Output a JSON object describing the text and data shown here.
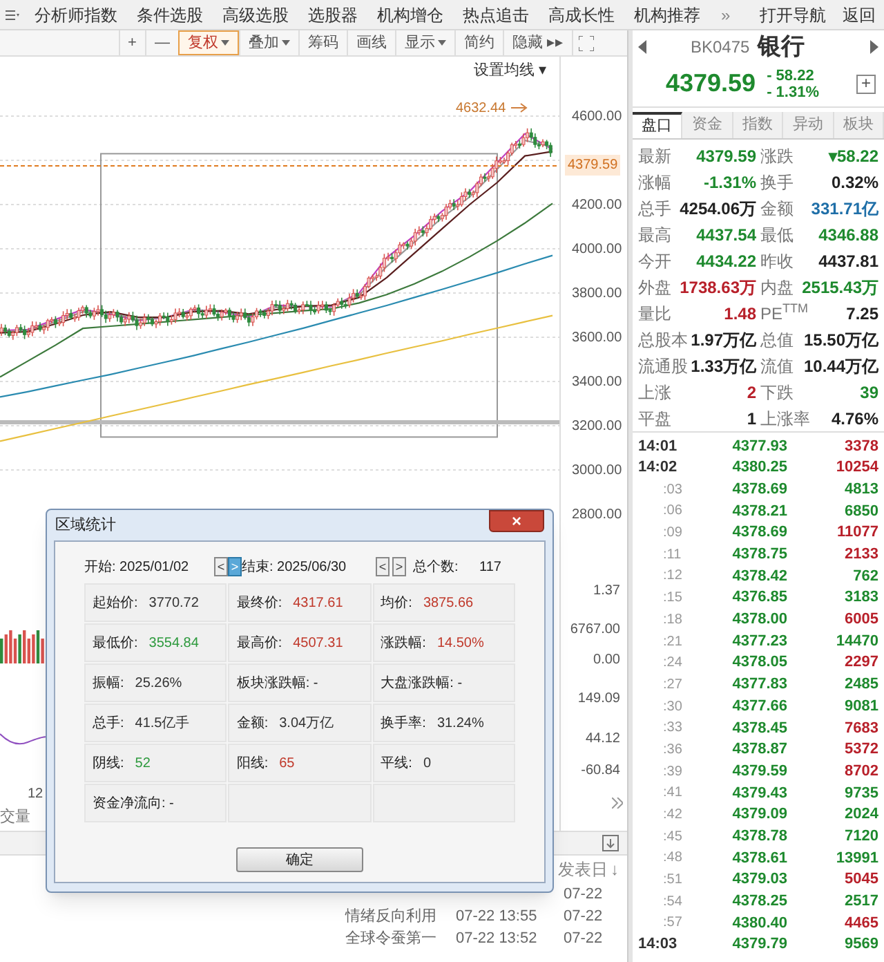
{
  "nav": {
    "items": [
      "分析师指数",
      "条件选股",
      "高级选股",
      "选股器",
      "机构增仓",
      "热点追击",
      "高成长性",
      "机构推荐"
    ],
    "more": "»",
    "right": [
      "打开导航",
      "返回"
    ]
  },
  "toolbar": {
    "buttons": [
      {
        "label": "+",
        "dropdown": false,
        "selected": false
      },
      {
        "label": "—",
        "dropdown": false,
        "selected": false
      },
      {
        "label": "复权",
        "dropdown": true,
        "selected": true
      },
      {
        "label": "叠加",
        "dropdown": true,
        "selected": false
      },
      {
        "label": "筹码",
        "dropdown": false,
        "selected": false
      },
      {
        "label": "画线",
        "dropdown": false,
        "selected": false
      },
      {
        "label": "显示",
        "dropdown": true,
        "selected": false
      },
      {
        "label": "简约",
        "dropdown": false,
        "selected": false
      },
      {
        "label": "隐藏 ▸▸",
        "dropdown": false,
        "selected": false
      }
    ],
    "ma_setting": "设置均线 ▾"
  },
  "chart": {
    "chart_data": {
      "type": "line",
      "yticks": [
        {
          "value": 4600,
          "label": "4600.00"
        },
        {
          "value": 4200,
          "label": "4200.00"
        },
        {
          "value": 4000,
          "label": "4000.00"
        },
        {
          "value": 3800,
          "label": "3800.00"
        },
        {
          "value": 3600,
          "label": "3600.00"
        },
        {
          "value": 3400,
          "label": "3400.00"
        },
        {
          "value": 3200,
          "label": "3200.00"
        },
        {
          "value": 3000,
          "label": "3000.00"
        },
        {
          "value": 2800,
          "label": "2800.00"
        }
      ],
      "ylim": [
        1368.75,
        4868.75
      ],
      "grid": true,
      "series": [
        {
          "color": "#c040c0",
          "values": [
            3630,
            3635,
            3680,
            3725,
            3705,
            3675,
            3690,
            3725,
            3715,
            3692,
            3745,
            3740,
            3738,
            3800,
            3960,
            4060,
            4170,
            4260,
            4390,
            4520,
            4450
          ]
        },
        {
          "color": "#999999",
          "values": [
            3625,
            3630,
            3670,
            3715,
            3710,
            3680,
            3690,
            3720,
            3718,
            3698,
            3735,
            3742,
            3742,
            3790,
            3920,
            4030,
            4140,
            4235,
            4360,
            4490,
            4460
          ]
        },
        {
          "color": "#5a1f1f",
          "values": [
            3620,
            3625,
            3660,
            3700,
            3715,
            3690,
            3690,
            3715,
            3720,
            3705,
            3725,
            3740,
            3745,
            3780,
            3870,
            3980,
            4090,
            4200,
            4300,
            4420,
            4440
          ]
        },
        {
          "color": "#3d7a3d",
          "values": [
            3420,
            3492,
            3564,
            3640,
            3650,
            3660,
            3670,
            3680,
            3690,
            3700,
            3710,
            3720,
            3729,
            3755,
            3793,
            3841,
            3898,
            3964,
            4036,
            4116,
            4205
          ]
        },
        {
          "color": "#2a8bb0",
          "values": [
            3330,
            3354,
            3380,
            3406,
            3432,
            3460,
            3488,
            3517,
            3548,
            3578,
            3610,
            3642,
            3676,
            3710,
            3744,
            3780,
            3816,
            3854,
            3892,
            3932,
            3970
          ]
        },
        {
          "color": "#e8c040",
          "values": [
            3130,
            3158,
            3187,
            3215,
            3244,
            3272,
            3300,
            3329,
            3357,
            3386,
            3414,
            3442,
            3471,
            3499,
            3528,
            3556,
            3584,
            3613,
            3641,
            3670,
            3698
          ]
        }
      ]
    },
    "high_label": "4632.44",
    "current_price": "4379.59",
    "lower_axis": [
      "1.37",
      "6767.00",
      "0.00",
      "149.09",
      "44.12",
      "-60.84"
    ],
    "x_label": "12",
    "panel_label": "交量"
  },
  "news": {
    "column": "发表日",
    "sort_arrow": "↓",
    "rows": [
      {
        "date": "07-22"
      },
      {
        "title": "情绪反向利用",
        "time": "07-22 13:55",
        "date": "07-22"
      },
      {
        "title": "全球令蚕第一",
        "time": "07-22 13:52",
        "date": "07-22"
      }
    ]
  },
  "dialog": {
    "title": "区域统计",
    "close": "×",
    "start": "开始: 2025/01/02",
    "end": "结束: 2025/06/30",
    "count_label": "总个数:",
    "count": "117",
    "arrows": [
      {
        "label": "<",
        "selected": false
      },
      {
        "label": ">",
        "selected": true
      },
      {
        "label": "<",
        "selected": false
      },
      {
        "label": ">",
        "selected": false
      }
    ],
    "cells": [
      {
        "kind": "stat",
        "label": "起始价:",
        "value": "3770.72"
      },
      {
        "kind": "stat",
        "label": "最终价:",
        "value": "4317.61",
        "color": "#c0392b"
      },
      {
        "kind": "stat",
        "label": "均价:",
        "value": "3875.66",
        "color": "#c0392b"
      },
      {
        "kind": "stat",
        "label": "最低价:",
        "value": "3554.84",
        "color": "#2e9a3e"
      },
      {
        "kind": "stat",
        "label": "最高价:",
        "value": "4507.31",
        "color": "#c0392b"
      },
      {
        "kind": "stat",
        "label": "涨跌幅:",
        "value": "14.50%",
        "color": "#c0392b"
      },
      {
        "kind": "stat",
        "label": "振幅:",
        "value": "25.26%"
      },
      {
        "kind": "stat",
        "label": "板块涨跌幅: -"
      },
      {
        "kind": "stat",
        "label": "大盘涨跌幅: -"
      },
      {
        "kind": "stat",
        "label": "总手:",
        "value": "41.5亿手"
      },
      {
        "kind": "stat",
        "label": "金额:",
        "value": "3.04万亿"
      },
      {
        "kind": "stat",
        "label": "换手率:",
        "value": "31.24%"
      },
      {
        "kind": "stat",
        "label": "阴线:",
        "value": "52",
        "color": "#2e9a3e"
      },
      {
        "kind": "stat",
        "label": "阳线:",
        "value": "65",
        "color": "#c0392b"
      },
      {
        "kind": "stat",
        "label": "平线:",
        "value": "0"
      },
      {
        "kind": "stat",
        "label": "资金净流向: -"
      },
      {
        "kind": "empty"
      },
      {
        "kind": "empty"
      }
    ],
    "ok": "确定"
  },
  "quote": {
    "code": "BK0475",
    "name": "银行",
    "price": "4379.59",
    "change": "- 58.22",
    "pct": "- 1.31%",
    "plus": "+",
    "tabs": [
      {
        "label": "盘口",
        "selected": true
      },
      {
        "label": "资金",
        "selected": false
      },
      {
        "label": "指数",
        "selected": false
      },
      {
        "label": "异动",
        "selected": false
      },
      {
        "label": "板块",
        "selected": false
      }
    ],
    "stats": [
      [
        {
          "label": "最新",
          "value": "4379.59",
          "color": "#1e8a2e"
        },
        {
          "label": "涨跌",
          "value": "▾58.22",
          "color": "#1e8a2e"
        }
      ],
      [
        {
          "label": "涨幅",
          "value": "-1.31%",
          "color": "#1e8a2e"
        },
        {
          "label": "换手",
          "value": "0.32%",
          "color": "#222222"
        }
      ],
      [
        {
          "label": "总手",
          "value": "4254.06万",
          "color": "#222222"
        },
        {
          "label": "金额",
          "value": "331.71亿",
          "color": "#1f6fa8"
        }
      ],
      [
        {
          "label": "最高",
          "value": "4437.54",
          "color": "#1e8a2e"
        },
        {
          "label": "最低",
          "value": "4346.88",
          "color": "#1e8a2e"
        }
      ],
      [
        {
          "label": "今开",
          "value": "4434.22",
          "color": "#1e8a2e"
        },
        {
          "label": "昨收",
          "value": "4437.81",
          "color": "#222222"
        }
      ],
      [
        {
          "label": "外盘",
          "value": "1738.63万",
          "color": "#b8202a"
        },
        {
          "label": "内盘",
          "value": "2515.43万",
          "color": "#1e8a2e"
        }
      ],
      [
        {
          "label": "量比",
          "value": "1.48",
          "color": "#b8202a"
        },
        {
          "label": "PE$^{TTM}$",
          "value": "7.25",
          "color": "#222222"
        }
      ],
      [
        {
          "label": "总股本",
          "value": "1.97万亿",
          "color": "#222222"
        },
        {
          "label": "总值",
          "value": "15.50万亿",
          "color": "#222222"
        }
      ],
      [
        {
          "label": "流通股",
          "value": "1.33万亿",
          "color": "#222222"
        },
        {
          "label": "流值",
          "value": "10.44万亿",
          "color": "#222222"
        }
      ],
      [
        {
          "label": "上涨",
          "value": "2",
          "color": "#b8202a"
        },
        {
          "label": "下跌",
          "value": "39",
          "color": "#1e8a2e"
        }
      ],
      [
        {
          "label": "平盘",
          "value": "1",
          "color": "#222222"
        },
        {
          "label": "上涨率",
          "value": "4.76%",
          "color": "#222222"
        }
      ]
    ],
    "ticks": [
      {
        "kind": "minute",
        "time": "14:01",
        "price": "4377.93",
        "volume": "3378",
        "color": "#b8202a"
      },
      {
        "kind": "minute",
        "time": "14:02",
        "price": "4380.25",
        "volume": "10254",
        "color": "#b8202a"
      },
      {
        "kind": "second",
        "time": ":03",
        "price": "4378.69",
        "volume": "4813",
        "color": "#1e8a2e"
      },
      {
        "kind": "second",
        "time": ":06",
        "price": "4378.21",
        "volume": "6850",
        "color": "#1e8a2e"
      },
      {
        "kind": "second",
        "time": ":09",
        "price": "4378.69",
        "volume": "11077",
        "color": "#b8202a"
      },
      {
        "kind": "second",
        "time": ":11",
        "price": "4378.75",
        "volume": "2133",
        "color": "#b8202a"
      },
      {
        "kind": "second",
        "time": ":12",
        "price": "4378.42",
        "volume": "762",
        "color": "#1e8a2e"
      },
      {
        "kind": "second",
        "time": ":15",
        "price": "4376.85",
        "volume": "3183",
        "color": "#1e8a2e"
      },
      {
        "kind": "second",
        "time": ":18",
        "price": "4378.00",
        "volume": "6005",
        "color": "#b8202a"
      },
      {
        "kind": "second",
        "time": ":21",
        "price": "4377.23",
        "volume": "14470",
        "color": "#1e8a2e"
      },
      {
        "kind": "second",
        "time": ":24",
        "price": "4378.05",
        "volume": "2297",
        "color": "#b8202a"
      },
      {
        "kind": "second",
        "time": ":27",
        "price": "4377.83",
        "volume": "2485",
        "color": "#1e8a2e"
      },
      {
        "kind": "second",
        "time": ":30",
        "price": "4377.66",
        "volume": "9081",
        "color": "#1e8a2e"
      },
      {
        "kind": "second",
        "time": ":33",
        "price": "4378.45",
        "volume": "7683",
        "color": "#b8202a"
      },
      {
        "kind": "second",
        "time": ":36",
        "price": "4378.87",
        "volume": "5372",
        "color": "#b8202a"
      },
      {
        "kind": "second",
        "time": ":39",
        "price": "4379.59",
        "volume": "8702",
        "color": "#b8202a"
      },
      {
        "kind": "second",
        "time": ":41",
        "price": "4379.43",
        "volume": "9735",
        "color": "#1e8a2e"
      },
      {
        "kind": "second",
        "time": ":42",
        "price": "4379.09",
        "volume": "2024",
        "color": "#1e8a2e"
      },
      {
        "kind": "second",
        "time": ":45",
        "price": "4378.78",
        "volume": "7120",
        "color": "#1e8a2e"
      },
      {
        "kind": "second",
        "time": ":48",
        "price": "4378.61",
        "volume": "13991",
        "color": "#1e8a2e"
      },
      {
        "kind": "second",
        "time": ":51",
        "price": "4379.03",
        "volume": "5045",
        "color": "#b8202a"
      },
      {
        "kind": "second",
        "time": ":54",
        "price": "4378.25",
        "volume": "2517",
        "color": "#1e8a2e"
      },
      {
        "kind": "second",
        "time": ":57",
        "price": "4380.40",
        "volume": "4465",
        "color": "#b8202a"
      },
      {
        "kind": "minute",
        "time": "14:03",
        "price": "4379.79",
        "volume": "9569",
        "color": "#1e8a2e"
      }
    ]
  }
}
